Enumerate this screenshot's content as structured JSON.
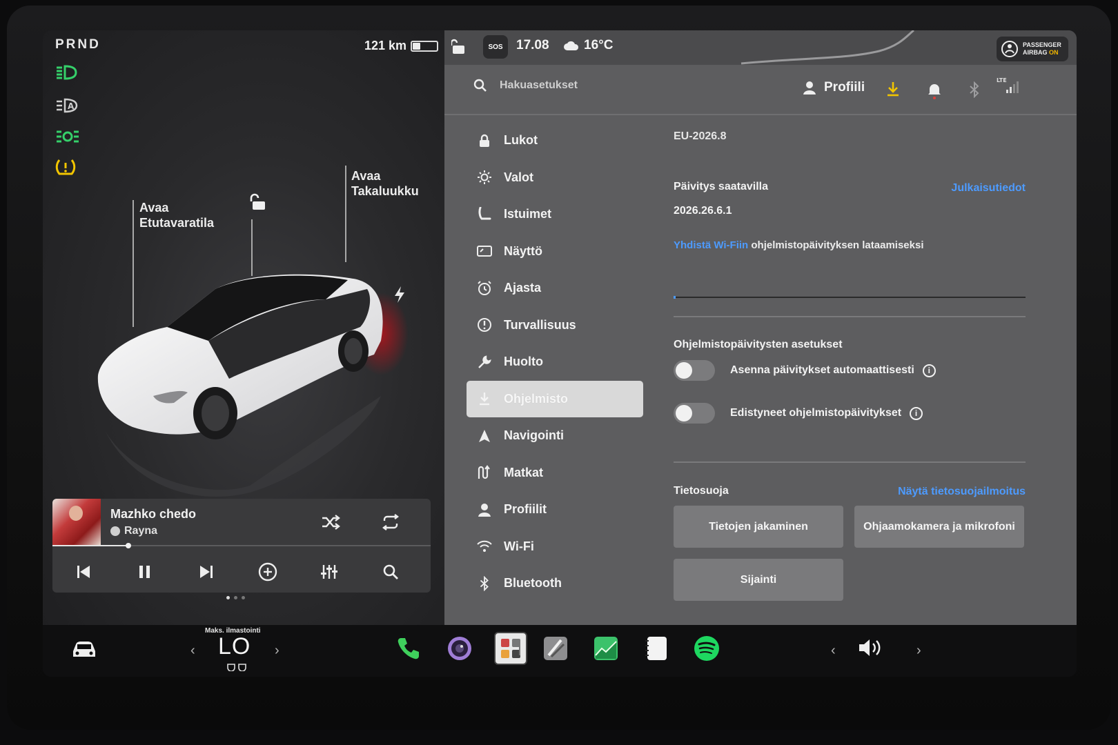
{
  "left": {
    "gear": "PRND",
    "range": "121 km",
    "battery_level": 0.3,
    "telltales": [
      "headlight-on-icon",
      "auto-highbeam-icon",
      "parking-lights-icon",
      "tire-pressure-warning-icon"
    ],
    "callouts": {
      "front_trunk": "Avaa\nEtutavaratila",
      "rear_trunk": "Avaa\nTakaluukku"
    }
  },
  "media": {
    "song": "Mazhko chedo",
    "artist": "Rayna",
    "progress": 0.2
  },
  "status": {
    "sos": "SOS",
    "time": "17.08",
    "temperature": "16°C",
    "airbag_line1": "PASSENGER",
    "airbag_line2": "AIRBAG",
    "airbag_state": "ON"
  },
  "topbar": {
    "search_placeholder": "Hakuasetukset",
    "profile_label": "Profiili",
    "signal_label": "LTE"
  },
  "menu": {
    "items": [
      {
        "label": "Lukot",
        "icon": "lock-icon"
      },
      {
        "label": "Valot",
        "icon": "sun-icon"
      },
      {
        "label": "Istuimet",
        "icon": "seat-icon"
      },
      {
        "label": "Näyttö",
        "icon": "display-icon"
      },
      {
        "label": "Ajasta",
        "icon": "alarm-icon"
      },
      {
        "label": "Turvallisuus",
        "icon": "safety-icon"
      },
      {
        "label": "Huolto",
        "icon": "wrench-icon"
      },
      {
        "label": "Ohjelmisto",
        "icon": "download-icon"
      },
      {
        "label": "Navigointi",
        "icon": "navigation-icon"
      },
      {
        "label": "Matkat",
        "icon": "trips-icon"
      },
      {
        "label": "Profiilit",
        "icon": "person-icon"
      },
      {
        "label": "Wi-Fi",
        "icon": "wifi-icon"
      },
      {
        "label": "Bluetooth",
        "icon": "bluetooth-icon"
      }
    ],
    "active_index": 7
  },
  "software": {
    "version": "EU-2026.8",
    "update_title": "Päivitys saatavilla",
    "release_notes": "Julkaisutiedot",
    "update_version": "2026.26.6.1",
    "wifi_link": "Yhdistä Wi-Fiin",
    "wifi_msg": " ohjelmistopäivityksen lataamiseksi",
    "download_progress": 0.0,
    "settings_title": "Ohjelmistopäivitysten asetukset",
    "auto_install": "Asenna päivitykset automaattisesti",
    "advanced_updates": "Edistyneet ohjelmistopäivitykset",
    "auto_install_on": false,
    "advanced_on": false
  },
  "privacy": {
    "title": "Tietosuoja",
    "notice_link": "Näytä tietosuojailmoitus",
    "btn_data_sharing": "Tietojen jakaminen",
    "btn_cabin_camera": "Ohjaamokamera ja mikrofoni",
    "btn_location": "Sijainti"
  },
  "dock": {
    "climate_label": "Maks. ilmastointi",
    "climate_value": "LO",
    "apps": [
      "phone-icon",
      "camera-icon",
      "toybox-icon",
      "dashcam-icon",
      "energy-icon",
      "notes-icon",
      "spotify-icon"
    ],
    "volume_icon": "volume-icon"
  }
}
